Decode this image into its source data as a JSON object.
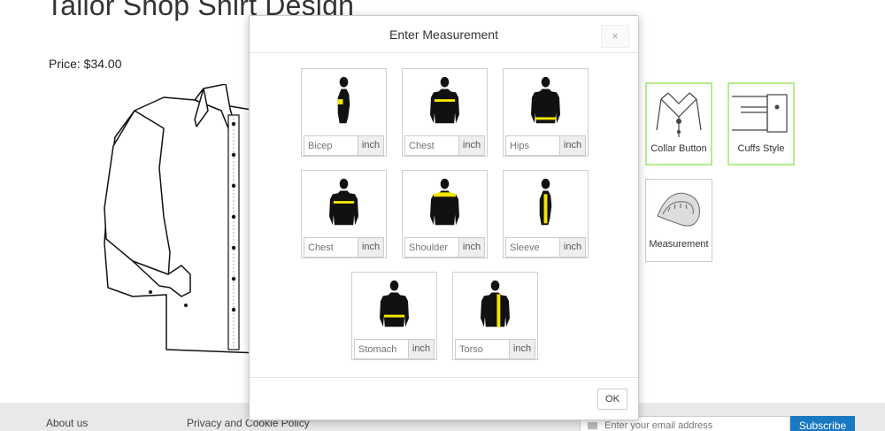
{
  "page": {
    "title": "Tailor Shop Shirt Design",
    "price": "Price: $34.00"
  },
  "options": [
    {
      "label": "Collar Button",
      "icon": "collar-button-icon",
      "selected": true
    },
    {
      "label": "Cuffs Style",
      "icon": "cuffs-style-icon",
      "selected": true
    },
    {
      "label": "Measurement",
      "icon": "measuring-tape-icon",
      "selected": false
    }
  ],
  "footer": {
    "links": [
      "About us",
      "Privacy and Cookie Policy"
    ],
    "newsletter_placeholder": "Enter your email address",
    "subscribe_label": "Subscribe"
  },
  "modal": {
    "title": "Enter Measurement",
    "close_label": "×",
    "ok_label": "OK",
    "unit": "inch",
    "fields": [
      {
        "placeholder": "Bicep",
        "highlight": "bicep"
      },
      {
        "placeholder": "Chest",
        "highlight": "chest"
      },
      {
        "placeholder": "Hips",
        "highlight": "hips"
      },
      {
        "placeholder": "Chest",
        "highlight": "chest-back"
      },
      {
        "placeholder": "Shoulder",
        "highlight": "shoulder"
      },
      {
        "placeholder": "Sleeve",
        "highlight": "sleeve"
      },
      {
        "placeholder": "Stomach",
        "highlight": "stomach"
      },
      {
        "placeholder": "Torso",
        "highlight": "torso"
      }
    ]
  },
  "colors": {
    "highlight": "#f2e600",
    "selected_border": "#b7ec8c",
    "subscribe_bg": "#1979c3",
    "footer_bg": "#e9e9e9"
  }
}
